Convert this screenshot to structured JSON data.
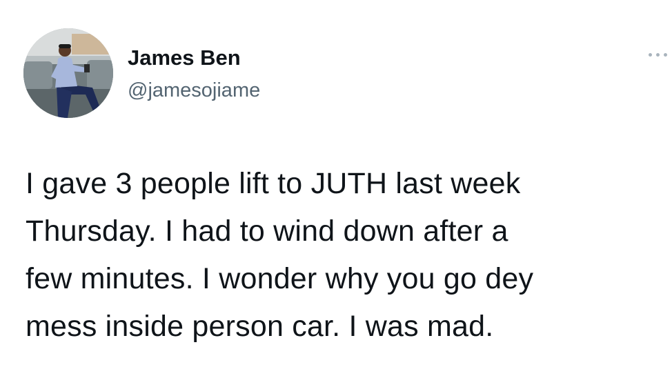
{
  "author": {
    "display_name": "James Ben",
    "handle": "@jamesojiame"
  },
  "more_options_icon": "ellipsis-icon",
  "tweet": {
    "lines": [
      "I gave 3 people lift to JUTH last week",
      "Thursday. I had to wind down after a",
      "few minutes. I wonder why you go dey",
      "mess inside person car. I was mad."
    ]
  },
  "colors": {
    "text_primary": "#0f1419",
    "text_secondary": "#536471",
    "icon_muted": "#a9b4bd",
    "background": "#ffffff"
  }
}
